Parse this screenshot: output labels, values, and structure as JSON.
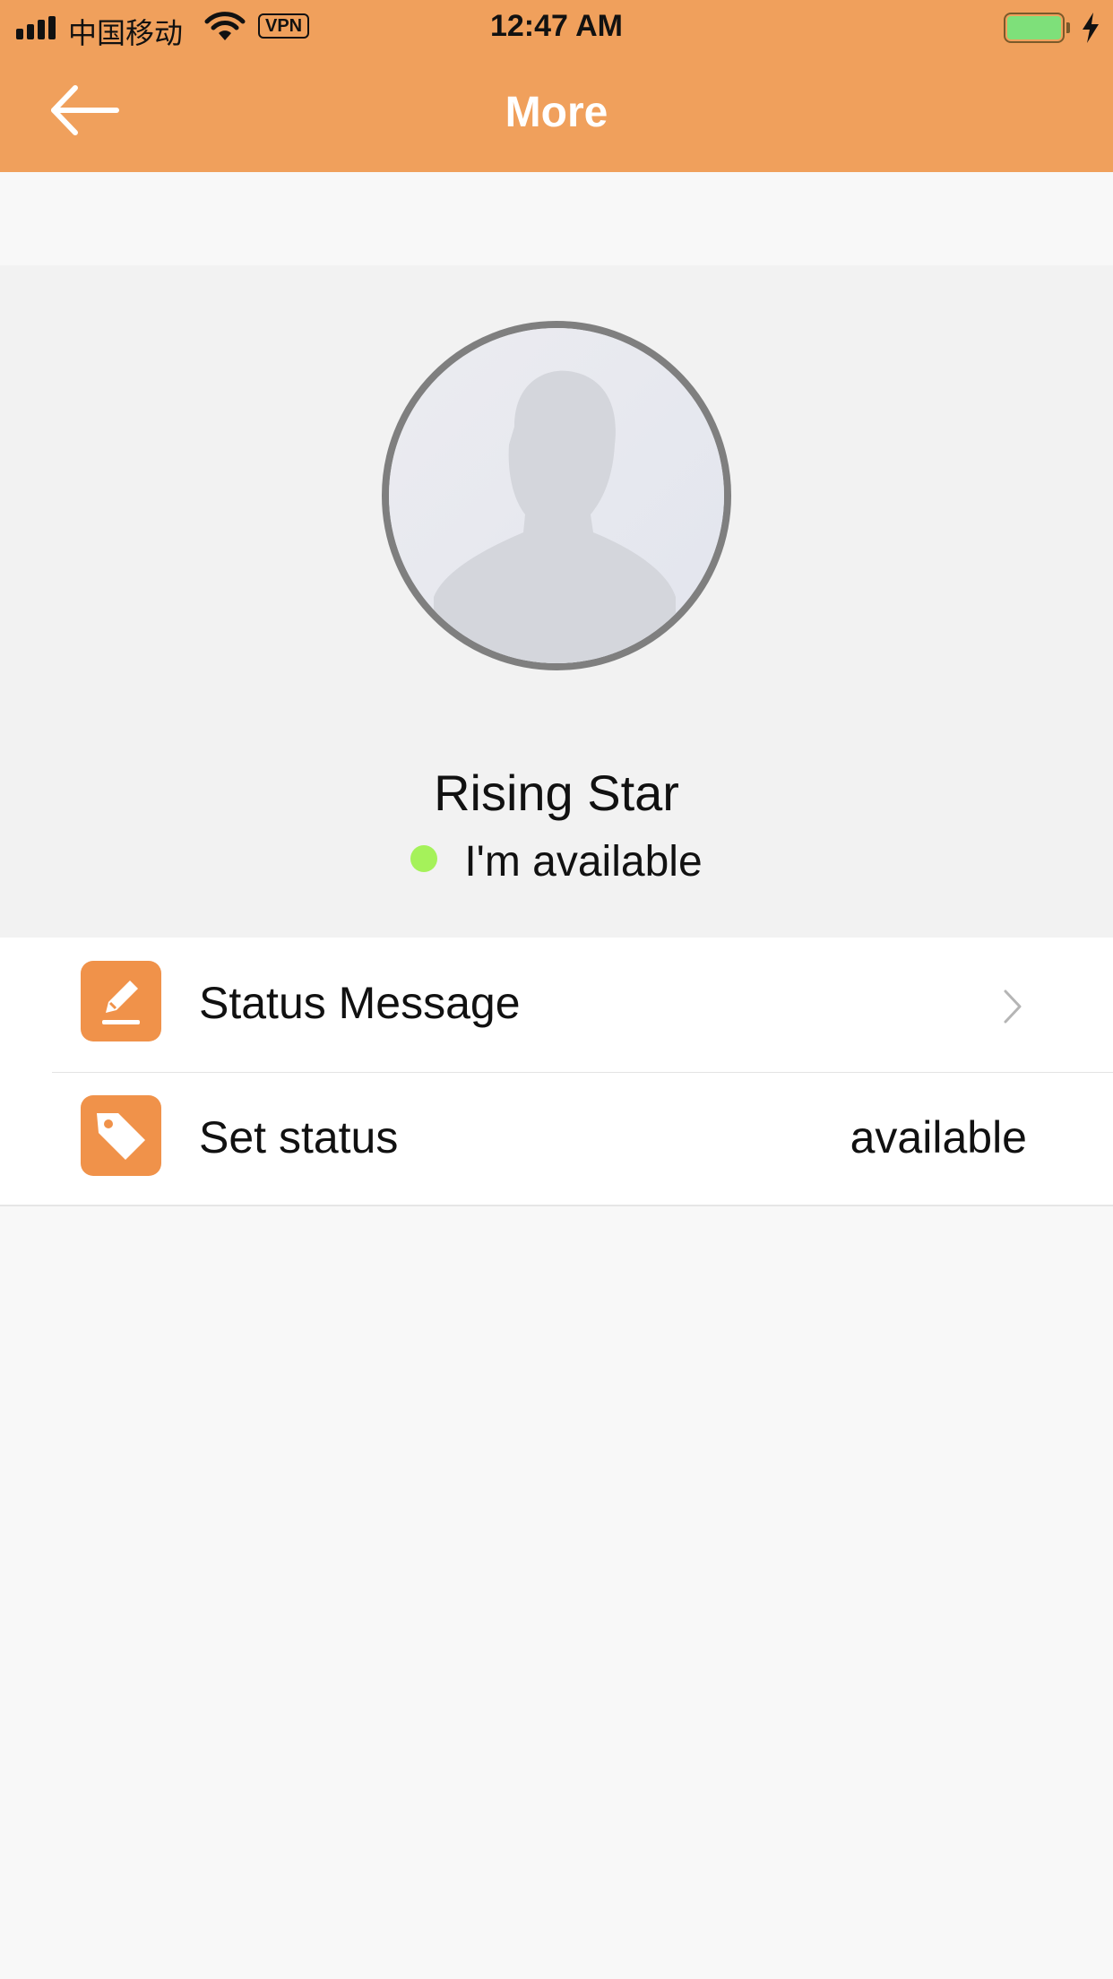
{
  "status_bar": {
    "carrier": "中国移动",
    "vpn": "VPN",
    "time": "12:47 AM",
    "battery_color": "#7ee07a"
  },
  "nav": {
    "title": "More",
    "back_icon": "arrow-left-icon"
  },
  "profile": {
    "name": "Rising Star",
    "presence_text": "I'm available",
    "presence_color": "#a5f25a",
    "avatar_icon": "default-avatar-silhouette"
  },
  "settings": [
    {
      "label": "Status Message",
      "value": "",
      "icon": "edit-pencil-icon",
      "has_chevron": true
    },
    {
      "label": "Set status",
      "value": "available",
      "icon": "tag-icon",
      "has_chevron": false
    }
  ],
  "colors": {
    "header": "#f0a05c",
    "icon_bg": "#f0924a"
  }
}
